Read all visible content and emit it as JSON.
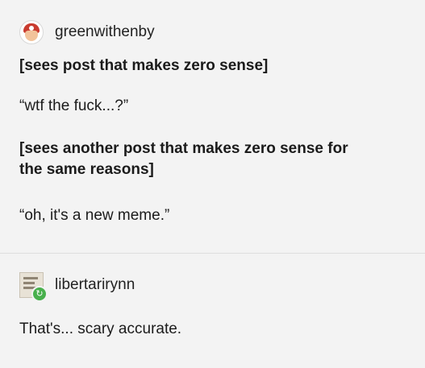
{
  "post_1": {
    "username": "greenwithenby",
    "avatar_icon": "mario-avatar-icon",
    "lines": [
      "[sees post that makes zero sense]",
      "“wtf the fuck...?”",
      "[sees another post that makes zero sense for\nthe same reasons]",
      "“oh, it's a new meme.”"
    ]
  },
  "post_2": {
    "username": "libertarirynn",
    "avatar_icon": "sticker-avatar-icon",
    "reblog_icon": "reblog-icon",
    "text": "That's... scary accurate."
  }
}
